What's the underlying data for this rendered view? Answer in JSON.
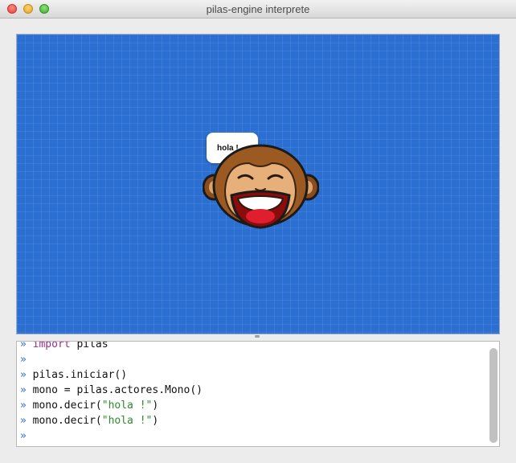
{
  "window": {
    "title": "pilas-engine interprete"
  },
  "canvas": {
    "speech_bubble": "hola !",
    "actor": "monkey"
  },
  "console": {
    "prompt": "»",
    "lines": [
      {
        "prefix": "import",
        "rest": " pilas"
      },
      {
        "text": ""
      },
      {
        "text": "pilas.iniciar()"
      },
      {
        "text": "mono = pilas.actores.Mono()"
      },
      {
        "call": "mono.decir(",
        "string": "\"hola !\"",
        "end": ")"
      },
      {
        "call": "mono.decir(",
        "string": "\"hola !\"",
        "end": ")"
      },
      {
        "text": ""
      }
    ]
  },
  "colors": {
    "canvas_bg": "#2a6fd1",
    "prompt": "#2d6ad1",
    "keyword": "#9b2d8a",
    "string": "#2e8b2e"
  },
  "icons": [
    "close-icon",
    "minimize-icon",
    "maximize-icon",
    "monkey-actor"
  ]
}
